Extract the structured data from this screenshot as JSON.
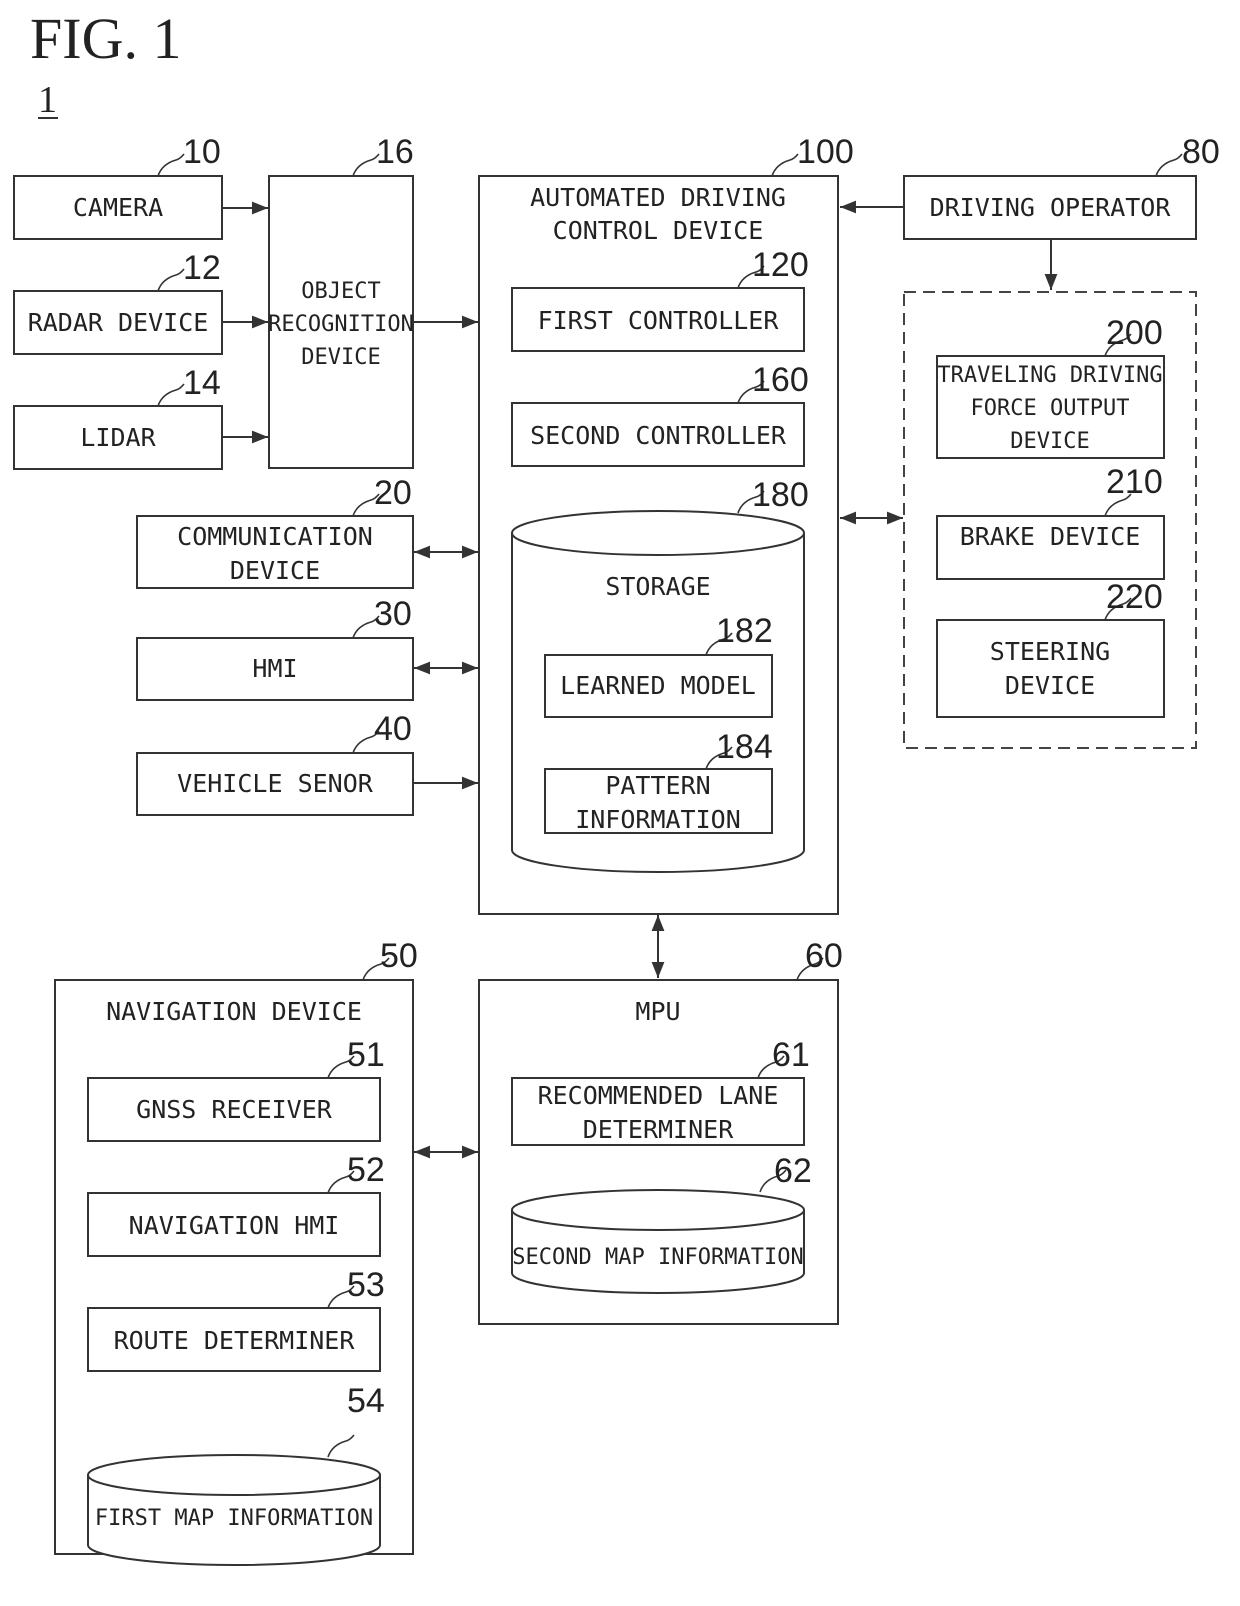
{
  "figure": {
    "title": "FIG. 1",
    "system_ref": "1"
  },
  "blocks": {
    "camera": {
      "ref": "10",
      "label": [
        "CAMERA"
      ]
    },
    "radar": {
      "ref": "12",
      "label": [
        "RADAR DEVICE"
      ]
    },
    "lidar": {
      "ref": "14",
      "label": [
        "LIDAR"
      ]
    },
    "object_recognition": {
      "ref": "16",
      "label": [
        "OBJECT",
        "RECOGNITION",
        "DEVICE"
      ]
    },
    "communication": {
      "ref": "20",
      "label": [
        "COMMUNICATION",
        "DEVICE"
      ]
    },
    "hmi": {
      "ref": "30",
      "label": [
        "HMI"
      ]
    },
    "vehicle_sensor": {
      "ref": "40",
      "label": [
        "VEHICLE SENOR"
      ]
    },
    "automated_driving": {
      "ref": "100",
      "label": [
        "AUTOMATED DRIVING",
        "CONTROL DEVICE"
      ]
    },
    "first_controller": {
      "ref": "120",
      "label": [
        "FIRST CONTROLLER"
      ]
    },
    "second_controller": {
      "ref": "160",
      "label": [
        "SECOND CONTROLLER"
      ]
    },
    "storage": {
      "ref": "180",
      "label": [
        "STORAGE"
      ]
    },
    "learned_model": {
      "ref": "182",
      "label": [
        "LEARNED MODEL"
      ]
    },
    "pattern_information": {
      "ref": "184",
      "label": [
        "PATTERN",
        "INFORMATION"
      ]
    },
    "driving_operator": {
      "ref": "80",
      "label": [
        "DRIVING OPERATOR"
      ]
    },
    "traveling_force": {
      "ref": "200",
      "label": [
        "TRAVELING DRIVING",
        "FORCE OUTPUT",
        "DEVICE"
      ]
    },
    "brake": {
      "ref": "210",
      "label": [
        "BRAKE DEVICE"
      ]
    },
    "steering": {
      "ref": "220",
      "label": [
        "STEERING",
        "DEVICE"
      ]
    },
    "navigation": {
      "ref": "50",
      "label": [
        "NAVIGATION DEVICE"
      ]
    },
    "gnss": {
      "ref": "51",
      "label": [
        "GNSS RECEIVER"
      ]
    },
    "navigation_hmi": {
      "ref": "52",
      "label": [
        "NAVIGATION HMI"
      ]
    },
    "route_determiner": {
      "ref": "53",
      "label": [
        "ROUTE DETERMINER"
      ]
    },
    "first_map": {
      "ref": "54",
      "label": [
        "FIRST MAP INFORMATION"
      ]
    },
    "mpu": {
      "ref": "60",
      "label": [
        "MPU"
      ]
    },
    "recommended_lane": {
      "ref": "61",
      "label": [
        "RECOMMENDED LANE",
        "DETERMINER"
      ]
    },
    "second_map": {
      "ref": "62",
      "label": [
        "SECOND MAP INFORMATION"
      ]
    }
  },
  "connections": [
    {
      "from": "camera",
      "to": "object_recognition",
      "type": "one-way"
    },
    {
      "from": "radar",
      "to": "object_recognition",
      "type": "one-way"
    },
    {
      "from": "lidar",
      "to": "object_recognition",
      "type": "one-way"
    },
    {
      "from": "object_recognition",
      "to": "automated_driving",
      "type": "one-way"
    },
    {
      "from": "communication",
      "to": "automated_driving",
      "type": "two-way"
    },
    {
      "from": "hmi",
      "to": "automated_driving",
      "type": "two-way"
    },
    {
      "from": "vehicle_sensor",
      "to": "automated_driving",
      "type": "one-way"
    },
    {
      "from": "driving_operator",
      "to": "automated_driving",
      "type": "one-way"
    },
    {
      "from": "driving_operator",
      "to": "actuator_group",
      "type": "one-way"
    },
    {
      "from": "automated_driving",
      "to": "actuator_group",
      "type": "two-way"
    },
    {
      "from": "automated_driving",
      "to": "mpu",
      "type": "two-way"
    },
    {
      "from": "navigation",
      "to": "mpu",
      "type": "two-way"
    }
  ]
}
